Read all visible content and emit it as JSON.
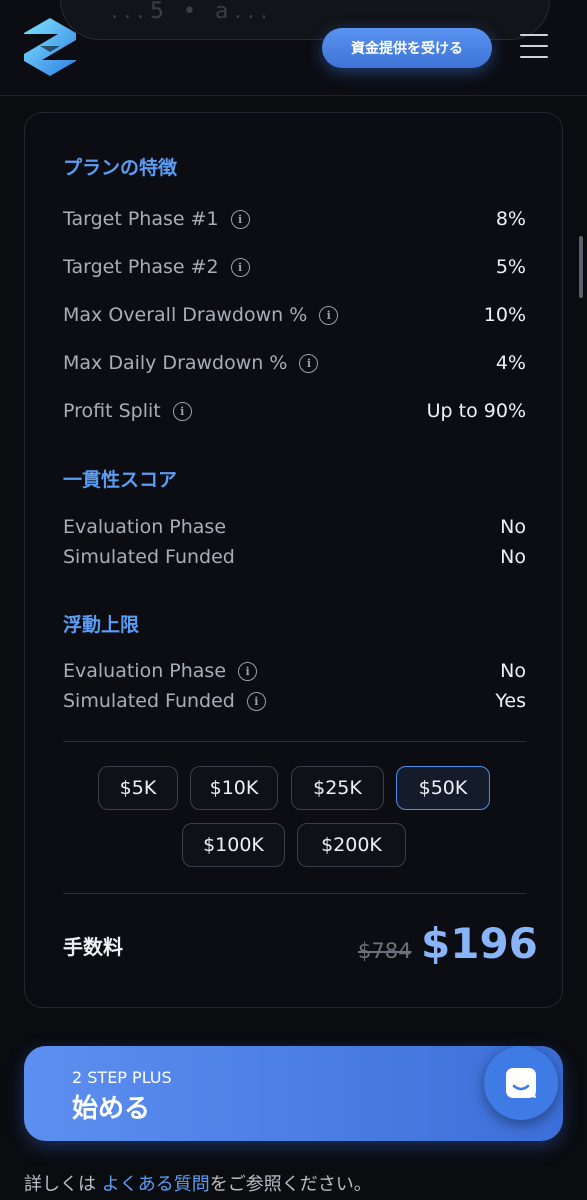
{
  "header": {
    "cta_label": "資金提供を受ける",
    "ghost_text": "...5 • a..."
  },
  "plan_features": {
    "title": "プランの特徴",
    "rows": [
      {
        "label": "Target Phase #1",
        "value": "8%"
      },
      {
        "label": "Target Phase #2",
        "value": "5%"
      },
      {
        "label": "Max Overall Drawdown %",
        "value": "10%"
      },
      {
        "label": "Max Daily Drawdown %",
        "value": "4%"
      },
      {
        "label": "Profit Split",
        "value": "Up to 90%"
      }
    ]
  },
  "consistency": {
    "title": "一貫性スコア",
    "rows": [
      {
        "label": "Evaluation Phase",
        "value": "No"
      },
      {
        "label": "Simulated Funded",
        "value": "No"
      }
    ]
  },
  "floating_cap": {
    "title": "浮動上限",
    "rows": [
      {
        "label": "Evaluation Phase",
        "value": "No"
      },
      {
        "label": "Simulated Funded",
        "value": "Yes"
      }
    ]
  },
  "account_sizes": {
    "options": [
      "$5K",
      "$10K",
      "$25K",
      "$50K",
      "$100K",
      "$200K"
    ],
    "selected": "$50K"
  },
  "fee": {
    "label": "手数料",
    "old_price": "$784",
    "new_price": "$196"
  },
  "start": {
    "plan_name": "2 STEP PLUS",
    "label": "始める"
  },
  "faq_note": {
    "prefix": "詳しくは ",
    "link": "よくある質問",
    "suffix": "をご参照ください。"
  },
  "colors": {
    "accent": "#5b9cf4",
    "price": "#8ab4f8",
    "background": "#0a0c10"
  }
}
